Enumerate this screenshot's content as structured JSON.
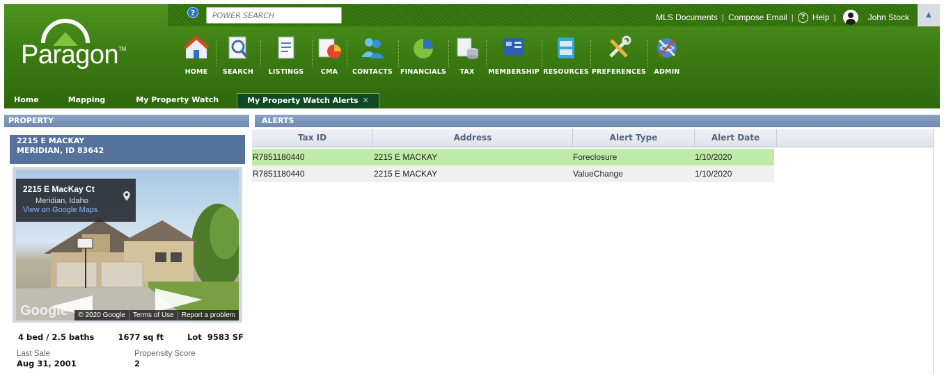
{
  "header": {
    "search_placeholder": "POWER SEARCH",
    "help_badge": "?",
    "links": {
      "mls_documents": "MLS Documents",
      "compose_email": "Compose Email",
      "help": "Help",
      "user_name": "John Stock"
    },
    "separator": "|",
    "help_symbol": "?",
    "collapse_symbol": "▲",
    "logo": {
      "text": "Paragon",
      "tm": "TM"
    }
  },
  "nav": [
    {
      "label": "HOME",
      "icon": "home-icon"
    },
    {
      "label": "SEARCH",
      "icon": "search-icon"
    },
    {
      "label": "LISTINGS",
      "icon": "listings-icon"
    },
    {
      "label": "CMA",
      "icon": "cma-icon"
    },
    {
      "label": "CONTACTS",
      "icon": "contacts-icon"
    },
    {
      "label": "FINANCIALS",
      "icon": "financials-icon"
    },
    {
      "label": "TAX",
      "icon": "tax-icon"
    },
    {
      "label": "MEMBERSHIP",
      "icon": "membership-icon"
    },
    {
      "label": "RESOURCES",
      "icon": "resources-icon"
    },
    {
      "label": "PREFERENCES",
      "icon": "preferences-icon"
    },
    {
      "label": "ADMIN",
      "icon": "admin-icon"
    }
  ],
  "tabs": [
    {
      "label": "Home"
    },
    {
      "label": "Mapping"
    },
    {
      "label": "My Property Watch"
    },
    {
      "label": "My Property Watch Alerts",
      "active": true,
      "close": "✕"
    }
  ],
  "property": {
    "section_title": "PROPERTY",
    "address_line1": "2215 E MACKAY",
    "address_line2": "MERIDIAN, ID 83642",
    "map_card": {
      "title": "2215 E MacKay Ct",
      "subtitle": "Meridian, Idaho",
      "link": "View on Google Maps"
    },
    "map_footer": {
      "copyright": "© 2020 Google",
      "terms": "Terms of Use",
      "report": "Report a problem"
    },
    "map_logo": "Google",
    "beds_baths": "4 bed / 2.5 baths",
    "sqft": "1677 sq ft",
    "lot": "Lot  9583 SF",
    "last_sale_label": "Last Sale",
    "last_sale_value": "Aug 31, 2001",
    "propensity_label": "Propensity Score",
    "propensity_value": "2"
  },
  "alerts": {
    "section_title": "ALERTS",
    "columns": [
      "Tax ID",
      "Address",
      "Alert Type",
      "Alert Date"
    ],
    "rows": [
      {
        "tax_id": "R7851180440",
        "address": "2215 E MACKAY",
        "alert_type": "Foreclosure",
        "alert_date": "1/10/2020",
        "highlighted": true
      },
      {
        "tax_id": "R7851180440",
        "address": "2215 E MACKAY",
        "alert_type": "ValueChange",
        "alert_date": "1/10/2020",
        "highlighted": false
      }
    ]
  },
  "colors": {
    "header_green": "#3c7d12",
    "section_blue": "#6e89b0",
    "address_box": "#55729c",
    "row_highlight": "#c0eaa8",
    "active_tab": "#0f4a24"
  }
}
